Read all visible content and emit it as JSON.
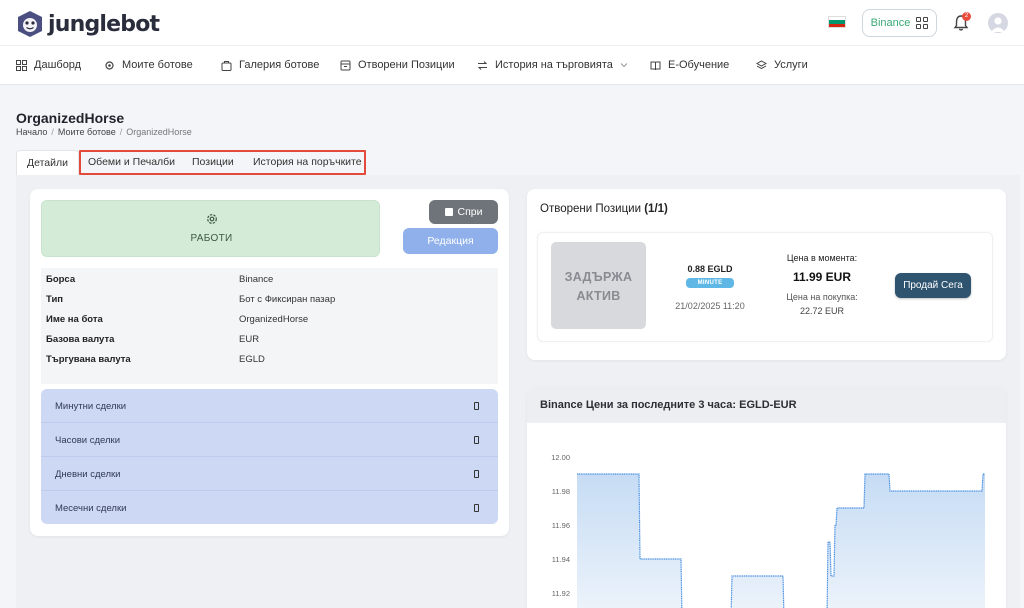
{
  "brand": {
    "name": "junglebot"
  },
  "header": {
    "exchange_label": "Binance",
    "notifications_count": "2"
  },
  "nav": [
    {
      "label": "Дашборд",
      "icon": "dashboard-grid-icon"
    },
    {
      "label": "Моите ботове",
      "icon": "bot-settings-icon"
    },
    {
      "label": "Галерия ботове",
      "icon": "gallery-bag-icon"
    },
    {
      "label": "Отворени Позиции",
      "icon": "open-positions-icon"
    },
    {
      "label": "История на търговията",
      "icon": "history-arrows-icon"
    },
    {
      "label": "E-Обучение",
      "icon": "book-icon"
    },
    {
      "label": "Услуги",
      "icon": "layers-icon"
    }
  ],
  "page": {
    "title": "OrganizedHorse",
    "breadcrumb": [
      "Начало",
      "Моите ботове",
      "OrganizedHorse"
    ]
  },
  "tabs": [
    "Детайли",
    "Обеми и Печалби",
    "Позиции",
    "История на поръчките"
  ],
  "bot": {
    "status": "РАБОТИ",
    "stop_label": "Спри",
    "edit_label": "Редакция",
    "info": [
      {
        "key": "Борса",
        "value": "Binance"
      },
      {
        "key": "Тип",
        "value": "Бот с Фиксиран пазар"
      },
      {
        "key": "Име на бота",
        "value": "OrganizedHorse"
      },
      {
        "key": "Базова валута",
        "value": "EUR"
      },
      {
        "key": "Търгувана валута",
        "value": "EGLD"
      }
    ],
    "deals": [
      "Минутни сделки",
      "Часови сделки",
      "Дневни сделки",
      "Месечни сделки"
    ]
  },
  "positions": {
    "title": "Отворени Позиции",
    "count": "(1/1)",
    "item": {
      "hold_line1": "ЗАДЪРЖА",
      "hold_line2": "АКТИВ",
      "amount": "0.88 EGLD",
      "badge": "MINUTE",
      "date": "21/02/2025 11:20",
      "current_price_label": "Цена в момента:",
      "current_price": "11.99 EUR",
      "buy_price_label": "Цена на покупка:",
      "buy_price": "22.72 EUR",
      "sell_label": "Продай Сега"
    }
  },
  "colors": {
    "accent_green": "#3aa876",
    "status_bg": "#d4ecd7",
    "edit_blue": "#8fb0ea",
    "sell_dark": "#2f5470",
    "chart_line": "#4a90e2"
  },
  "chart_data": {
    "type": "area",
    "title": "Binance Цени за последните 3 часа: EGLD-EUR",
    "ytick_labels": [
      "12.00",
      "11.98",
      "11.96",
      "11.94",
      "11.92"
    ],
    "ylim": [
      11.905,
      12.0
    ],
    "x": [
      0,
      62,
      63,
      104,
      105,
      154,
      155,
      206,
      207,
      250,
      251,
      253,
      254,
      257,
      258,
      259,
      260,
      287,
      288,
      312,
      313,
      405,
      406,
      408
    ],
    "values": [
      11.99,
      11.99,
      11.94,
      11.94,
      11.905,
      11.905,
      11.93,
      11.93,
      11.905,
      11.905,
      11.95,
      11.95,
      11.93,
      11.93,
      11.96,
      11.96,
      11.97,
      11.97,
      11.99,
      11.99,
      11.98,
      11.98,
      11.99,
      11.99
    ]
  }
}
